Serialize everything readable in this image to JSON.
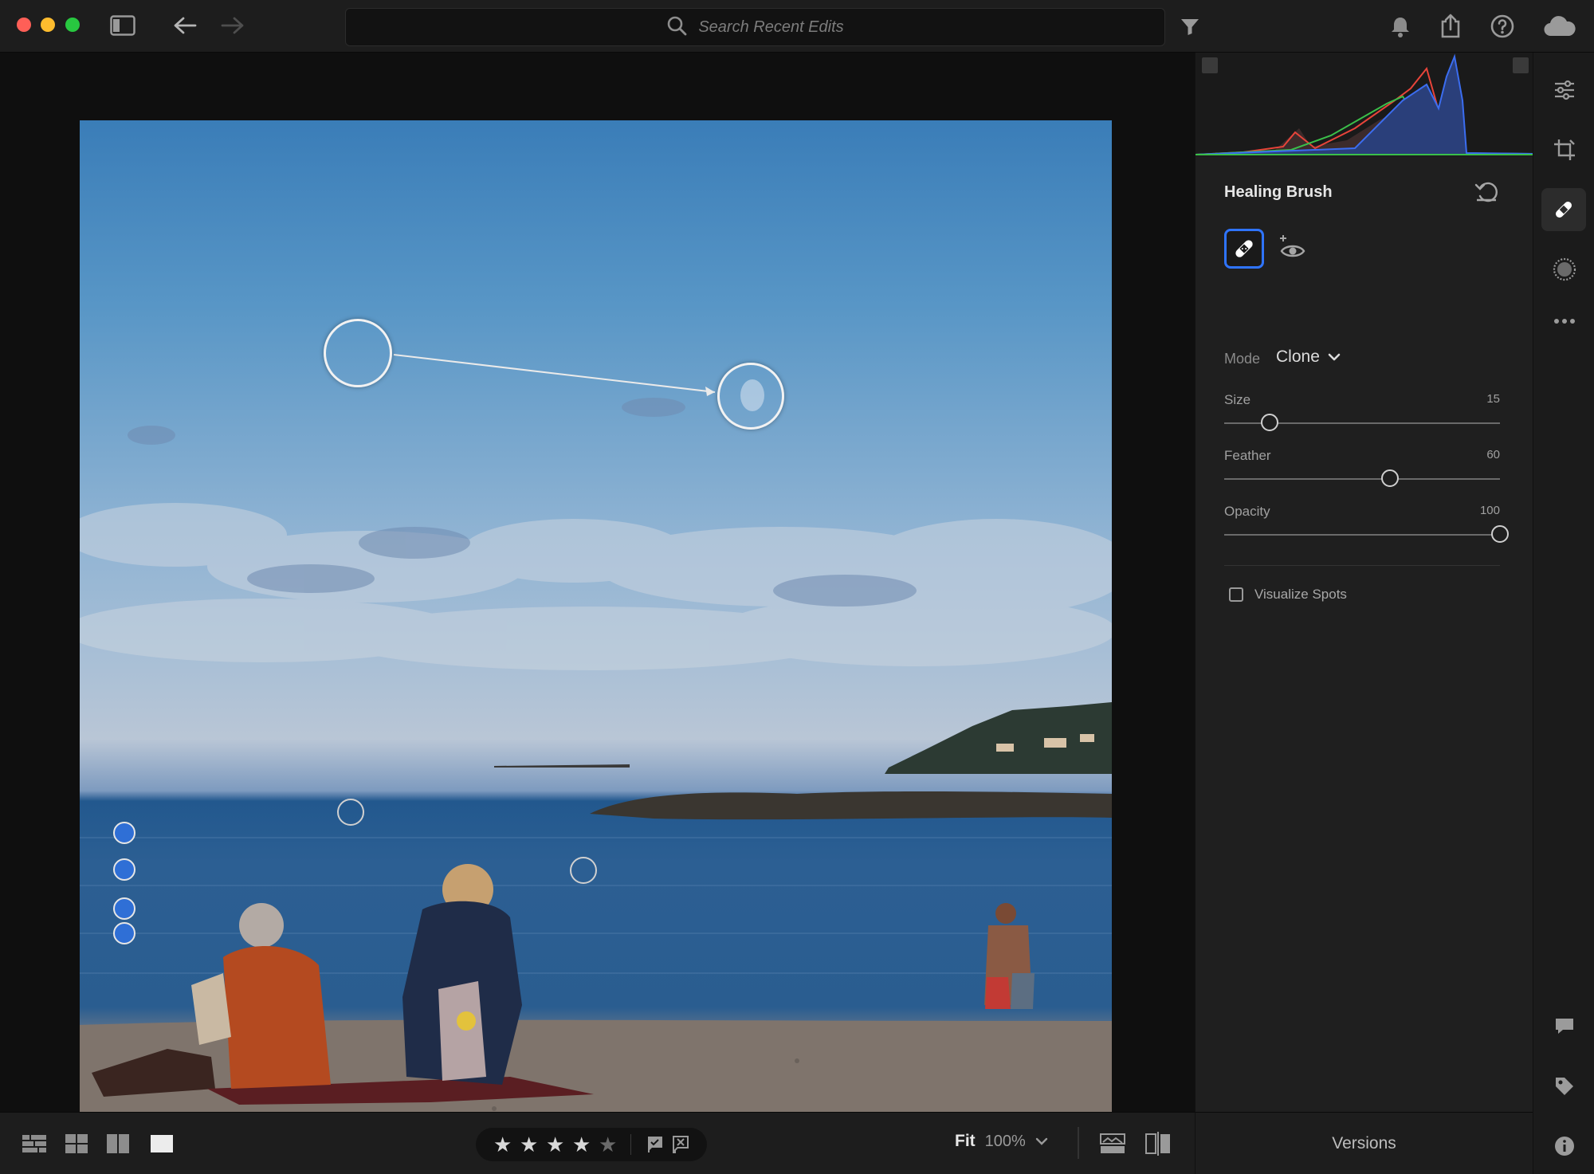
{
  "window": {
    "traffic_lights": {
      "close": "#ff5f57",
      "minimize": "#febc2e",
      "zoom": "#28c840"
    }
  },
  "toolbar": {
    "search_placeholder": "Search Recent Edits",
    "icons": [
      "sidebar-toggle-icon",
      "back-arrow-icon",
      "forward-arrow-icon",
      "search-icon",
      "filter-icon",
      "bell-icon",
      "share-icon",
      "help-icon",
      "cloud-icon"
    ]
  },
  "panel": {
    "title": "Healing Brush",
    "mode_label": "Mode",
    "mode_value": "Clone",
    "sliders": [
      {
        "label": "Size",
        "value": "15",
        "fraction": 0.165
      },
      {
        "label": "Feather",
        "value": "60",
        "fraction": 0.6
      },
      {
        "label": "Opacity",
        "value": "100",
        "fraction": 1.0
      }
    ],
    "visualize_spots_label": "Visualize Spots",
    "visualize_spots_checked": false
  },
  "rail_icons": [
    "edit-sliders-icon",
    "crop-icon",
    "healing-bandage-icon",
    "masking-icon",
    "more-icon",
    "comment-icon",
    "tag-icon",
    "info-icon"
  ],
  "bottom": {
    "view_icons": [
      "grid-small-icon",
      "grid-large-icon",
      "compare-icon",
      "single-view-icon"
    ],
    "rating_stars": 4,
    "rating_max": 5,
    "flag_icons": [
      "flag-pick-icon",
      "flag-reject-icon"
    ],
    "zoom_fit": "Fit",
    "zoom_percent": "100%",
    "versions_label": "Versions"
  },
  "colors": {
    "accent": "#2f74ff",
    "panel_bg": "#1f1f1f",
    "spot_blue": "#2f6fd6"
  }
}
